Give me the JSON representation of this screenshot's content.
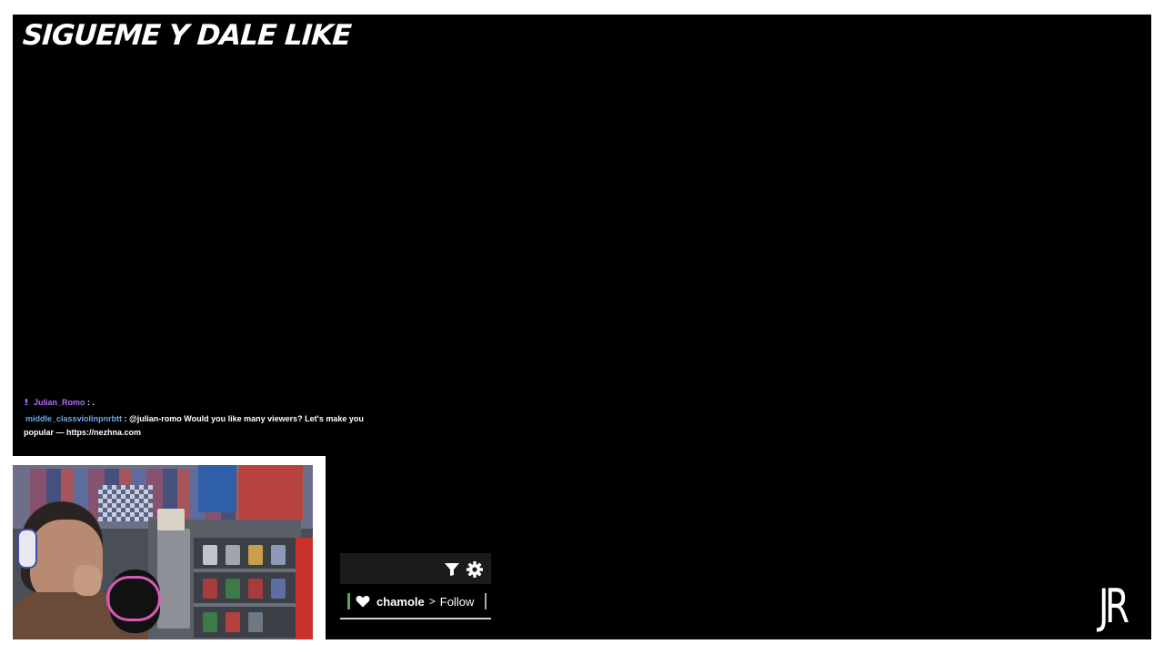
{
  "overlay": {
    "banner_text": "SIGUEME Y DALE LIKE",
    "logo_text": "JR"
  },
  "chat": {
    "messages": [
      {
        "user": "Julian_Romo",
        "separator": " : ",
        "text": ".",
        "user_color": "#b36bff",
        "badge_icon": "broadcaster-badge-icon"
      },
      {
        "user": "middle_classviolinpnrbtt",
        "separator": " : ",
        "text": "@julian-romo Would you like many viewers? Let's make you popular — https://nezhna.com",
        "user_color": "#6aa8e8"
      }
    ]
  },
  "alerts": {
    "toolbar": {
      "filter_icon": "filter-icon",
      "settings_icon": "gear-icon"
    },
    "items": [
      {
        "icon": "heart-icon",
        "user": "chamole",
        "arrow": ">",
        "action": "Follow",
        "accent": "#4caf50"
      }
    ]
  },
  "colors": {
    "background": "#000000",
    "frame": "#ffffff",
    "accent_green": "#4caf50"
  }
}
